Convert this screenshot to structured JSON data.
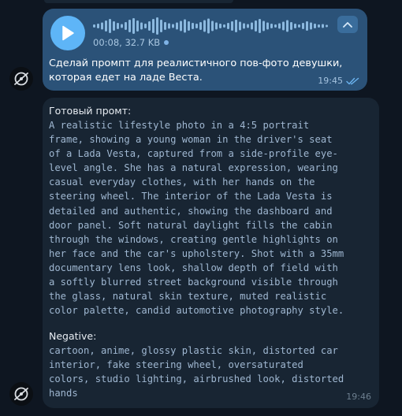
{
  "outgoing": {
    "voice": {
      "duration": "00:08",
      "size": "32.7 KB",
      "play_icon": "play-icon",
      "collapse_icon": "chevron-up-icon"
    },
    "text": "Сделай промпт для реалистичного пов-фото девушки, которая едет на ладе Веста.",
    "time": "19:45",
    "status_icon": "double-check-icon"
  },
  "incoming": {
    "heading": "Готовый промт:",
    "prompt_lines": [
      "A realistic lifestyle photo in a 4:5 portrait",
      "frame, showing a young woman in the driver's seat",
      "of a Lada Vesta, captured from a side-profile eye-",
      "level angle. She has a natural expression, wearing",
      "casual everyday clothes, with her hands on the",
      "steering wheel. The interior of the Lada Vesta is",
      "detailed and authentic, showing the dashboard and",
      "door panel. Soft natural daylight fills the cabin",
      "through the windows, creating gentle highlights on",
      "her face and the car's upholstery. Shot with a 35mm",
      "documentary lens look, shallow depth of field with",
      "a softly blurred street background visible through",
      "the glass, natural skin texture, muted realistic",
      "color palette, candid automotive photography style."
    ],
    "negative_label": "Negative:",
    "negative_lines": [
      "cartoon, anime, glossy plastic skin, distorted car",
      "interior, fake steering wheel, oversaturated",
      "colors, studio lighting, airbrushed look, distorted",
      "hands"
    ],
    "time": "19:46"
  },
  "colors": {
    "background": "#0e1621",
    "outgoing_bubble": "#2b5278",
    "incoming_bubble": "#182533",
    "accent": "#5eb5f7",
    "code_text": "#9fb7d1"
  }
}
